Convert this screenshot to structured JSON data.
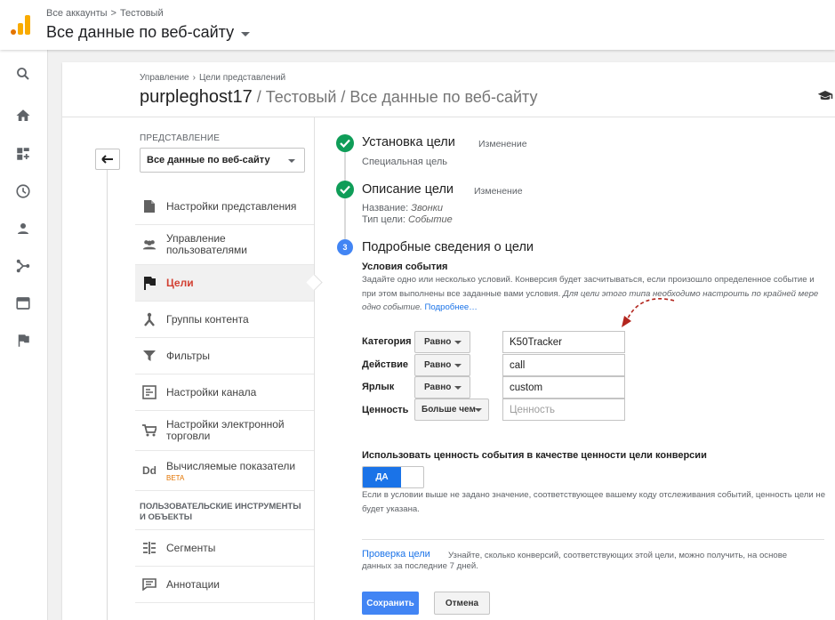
{
  "header": {
    "breadcrumb": [
      "Все аккаунты",
      "Тестовый"
    ],
    "breadcrumb_sep": ">",
    "account_title": "Все данные по веб-сайту"
  },
  "rail": {
    "icons": [
      "search-icon",
      "home-icon",
      "customization-icon",
      "realtime-clock-icon",
      "audience-person-icon",
      "acquisition-icon",
      "behavior-icon",
      "conversions-flag-icon"
    ]
  },
  "card": {
    "breadcrumb": [
      "Управление",
      "Цели представлений"
    ],
    "breadcrumb_sep": "›",
    "title_main": "purpleghost17",
    "title_rest": " / Тестовый / Все данные по веб-сайту"
  },
  "left_nav": {
    "view_label": "ПРЕДСТАВЛЕНИЕ",
    "view_value": "Все данные по веб-сайту",
    "items": [
      {
        "label": "Настройки представления",
        "icon": "document-icon"
      },
      {
        "label": "Управление пользователями",
        "icon": "users-icon"
      },
      {
        "label": "Цели",
        "icon": "flag-icon",
        "active": true
      },
      {
        "label": "Группы контента",
        "icon": "content-groups-icon"
      },
      {
        "label": "Фильтры",
        "icon": "filter-icon"
      },
      {
        "label": "Настройки канала",
        "icon": "channel-icon"
      },
      {
        "label": "Настройки электронной торговли",
        "icon": "cart-icon"
      },
      {
        "label": "Вычисляемые показатели",
        "icon": "dd-icon",
        "badge": "BETA"
      }
    ],
    "section_title": "ПОЛЬЗОВАТЕЛЬСКИЕ ИНСТРУМЕНТЫ И ОБЪЕКТЫ",
    "section_items": [
      {
        "label": "Сегменты",
        "icon": "segments-icon"
      },
      {
        "label": "Аннотации",
        "icon": "annotations-icon"
      }
    ]
  },
  "steps": {
    "step1": {
      "title": "Установка цели",
      "edit": "Изменение",
      "sub": "Специальная цель"
    },
    "step2": {
      "title": "Описание цели",
      "edit": "Изменение",
      "name_label": "Название:",
      "name_value": "Звонки",
      "type_label": "Тип цели:",
      "type_value": "Событие"
    },
    "step3": {
      "number": "3",
      "title": "Подробные сведения о цели"
    }
  },
  "conditions": {
    "heading": "Условия события",
    "desc_plain": "Задайте одно или несколько условий. Конверсия будет засчитываться, если произошло определенное событие и при этом выполнены все заданные вами условия.",
    "desc_italic": "Для цели этого типа необходимо настроить по крайней мере одно событие.",
    "desc_link": "Подробнее…",
    "rows": [
      {
        "label": "Категория",
        "operator": "Равно",
        "value": "K50Tracker",
        "placeholder": ""
      },
      {
        "label": "Действие",
        "operator": "Равно",
        "value": "call",
        "placeholder": ""
      },
      {
        "label": "Ярлык",
        "operator": "Равно",
        "value": "custom",
        "placeholder": ""
      },
      {
        "label": "Ценность",
        "operator": "Больше чем",
        "value": "",
        "placeholder": "Ценность"
      }
    ]
  },
  "value_toggle": {
    "heading": "Использовать ценность события в качестве ценности цели конверсии",
    "state_label": "ДА",
    "description": "Если в условии выше не задано значение, соответствующее вашему коду отслеживания событий, ценность цели не будет указана."
  },
  "verify": {
    "link": "Проверка цели",
    "desc": "Узнайте, сколько конверсий, соответствующих этой цели, можно получить, на основе",
    "desc2": "данных за последние 7 дней."
  },
  "buttons": {
    "save": "Сохранить",
    "cancel": "Отмена"
  },
  "colors": {
    "accent_blue": "#4285f4",
    "step_done_green": "#0f9d58",
    "active_nav_red": "#d23f31",
    "annotation_arrow": "#b3261e",
    "logo_orange": "#f9ab00"
  }
}
